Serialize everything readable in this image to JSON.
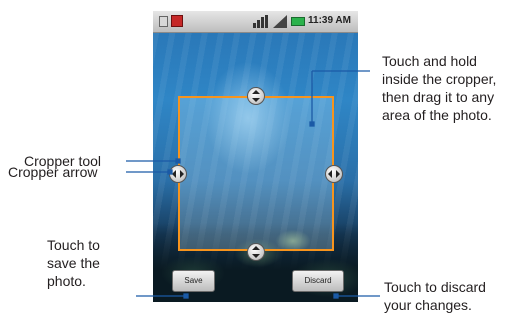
{
  "status_bar": {
    "time": "11:39 AM"
  },
  "buttons": {
    "save": "Save",
    "discard": "Discard"
  },
  "callouts": {
    "cropper_tool": "Cropper tool",
    "cropper_arrow": "Cropper arrow",
    "drag_line1": "Touch and hold",
    "drag_line2": "inside the cropper,",
    "drag_line3": "then drag it to any",
    "drag_line4": "area of the photo.",
    "save_line1": "Touch to",
    "save_line2": "save the",
    "save_line3": "photo.",
    "discard_line1": "Touch to discard",
    "discard_line2": "your changes."
  },
  "colors": {
    "cropper_border": "#f7941d",
    "battery_green": "#2bb24c",
    "callout_line": "#1b5aa6"
  },
  "icons": [
    "sd-card-icon",
    "notification-icon",
    "signal-icon",
    "battery-icon",
    "drag-handle-icon"
  ]
}
